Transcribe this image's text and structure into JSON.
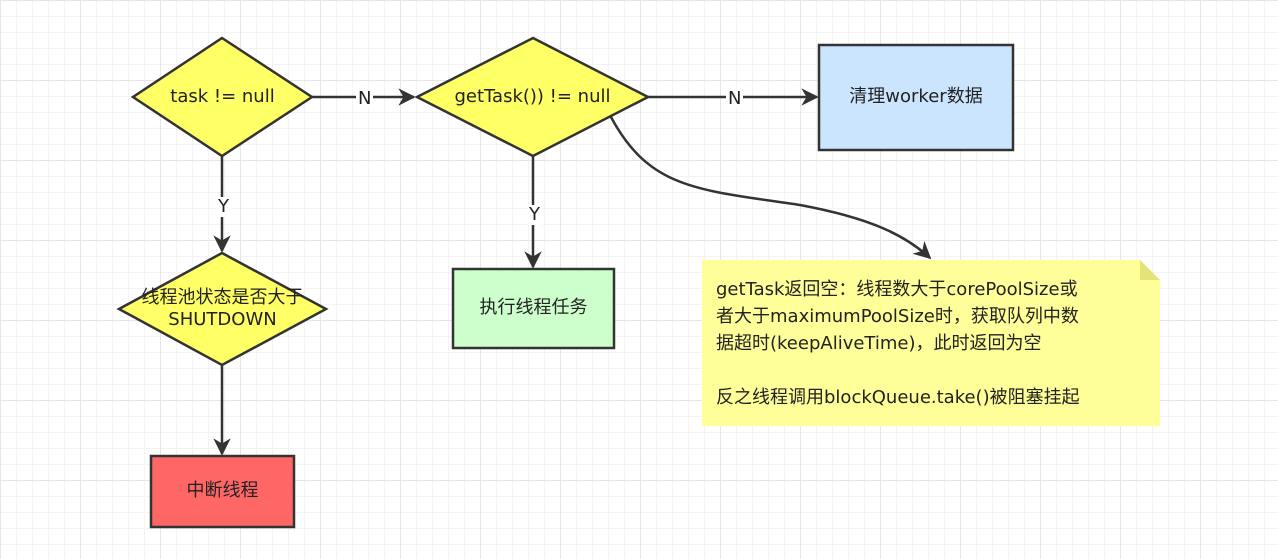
{
  "colors": {
    "diamond_fill": "#ffff66",
    "blue_fill": "#cce5ff",
    "green_fill": "#ccffcc",
    "red_fill": "#ff6666",
    "note_fill": "#ffff99",
    "stroke": "#333333"
  },
  "nodes": {
    "task_check": "task != null",
    "gettask_check": "getTask()) != null",
    "cleanup": "清理worker数据",
    "shutdown_check_line1": "线程池状态是否大于",
    "shutdown_check_line2": "SHUTDOWN",
    "execute_task": "执行线程任务",
    "interrupt": "中断线程"
  },
  "edges": {
    "task_to_gettask": "N",
    "gettask_to_cleanup": "N",
    "task_to_shutdown": "Y",
    "gettask_to_execute": "Y"
  },
  "note": {
    "line1": "getTask返回空：线程数大于corePoolSize或",
    "line2": "者大于maximumPoolSize时，获取队列中数",
    "line3": "据超时(keepAliveTime)，此时返回为空",
    "line4": "反之线程调用blockQueue.take()被阻塞挂起"
  }
}
